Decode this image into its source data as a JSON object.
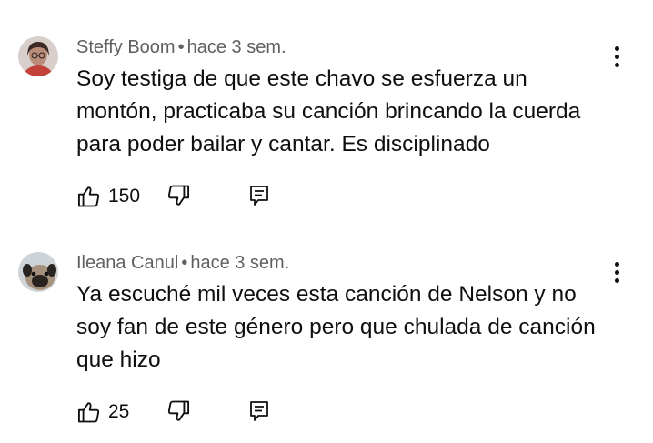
{
  "comments": [
    {
      "author": "Steffy Boom",
      "separator": "•",
      "time": "hace 3 sem.",
      "text_lines": [
        "Soy testiga de que este chavo se esfuerza un",
        "montón, practicaba su canción brincando la cuerda",
        "para poder bailar y cantar. Es disciplinado"
      ],
      "likes": "150",
      "avatar_icon": "woman-glasses-avatar",
      "avatar_colors": [
        "#b9a296",
        "#3b2a26",
        "#c2413a"
      ]
    },
    {
      "author": "Ileana Canul",
      "separator": "•",
      "time": "hace 3 sem.",
      "text_lines": [
        "Ya escuché mil veces esta canción de Nelson y no",
        "soy fan de este género pero que chulada de canción",
        "que hizo"
      ],
      "likes": "25",
      "avatar_icon": "pug-dog-avatar",
      "avatar_colors": [
        "#cdd3d6",
        "#8c7d6d",
        "#2a2420"
      ]
    }
  ],
  "icons": {
    "like": "thumbs-up-icon",
    "dislike": "thumbs-down-icon",
    "reply": "reply-comment-icon",
    "menu": "more-vertical-icon"
  },
  "colors": {
    "text": "#0f0f0f",
    "meta": "#606060",
    "background": "#ffffff"
  }
}
